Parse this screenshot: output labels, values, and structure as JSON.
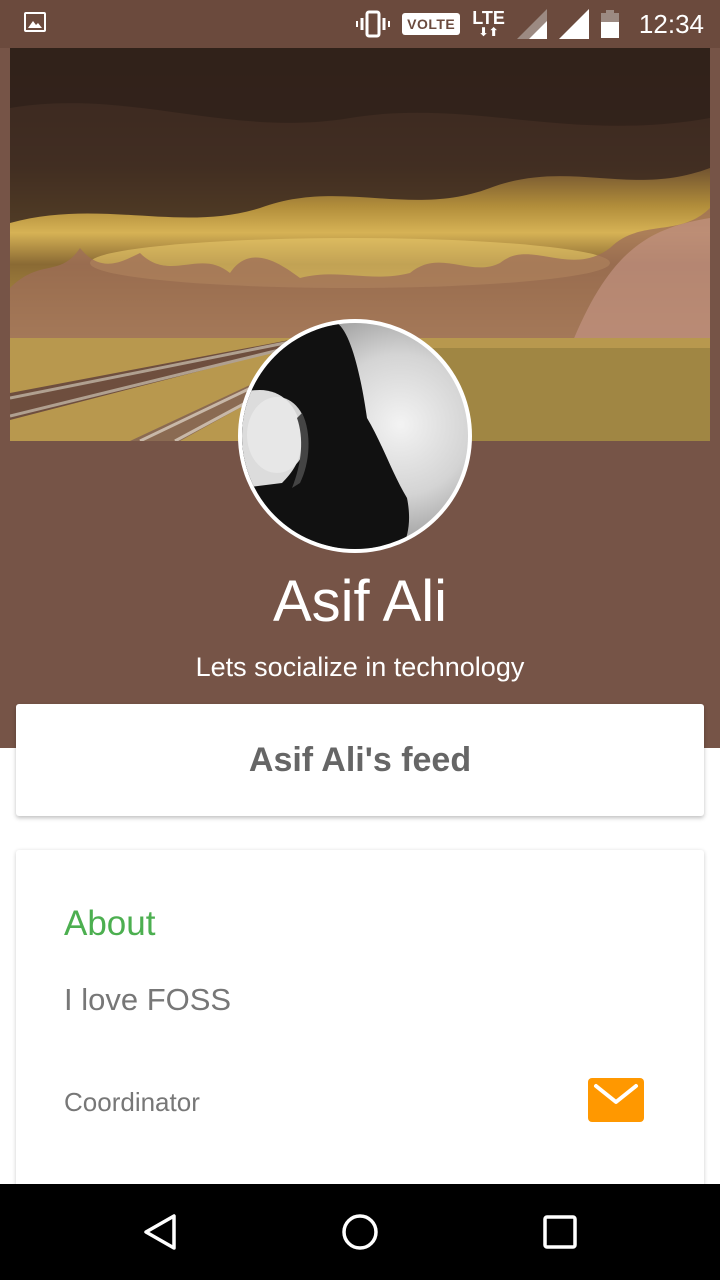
{
  "status_bar": {
    "volte": "VOLTE",
    "lte": "LTE",
    "time": "12:34",
    "icons": [
      "image-icon",
      "vibrate-icon",
      "lte-icon",
      "signal-icon",
      "signal-icon",
      "battery-icon"
    ]
  },
  "profile": {
    "name": "Asif Ali",
    "tagline": "Lets socialize in technology"
  },
  "feed": {
    "label": "Asif Ali's feed"
  },
  "about": {
    "title": "About",
    "text": "I love FOSS",
    "role": "Coordinator"
  },
  "nav": {
    "icons": [
      "back-icon",
      "home-icon",
      "recents-icon"
    ]
  },
  "colors": {
    "status_bar": "#6b4a3d",
    "header": "#765447",
    "accent_green": "#4caf50",
    "mail_orange": "#ff9800"
  }
}
